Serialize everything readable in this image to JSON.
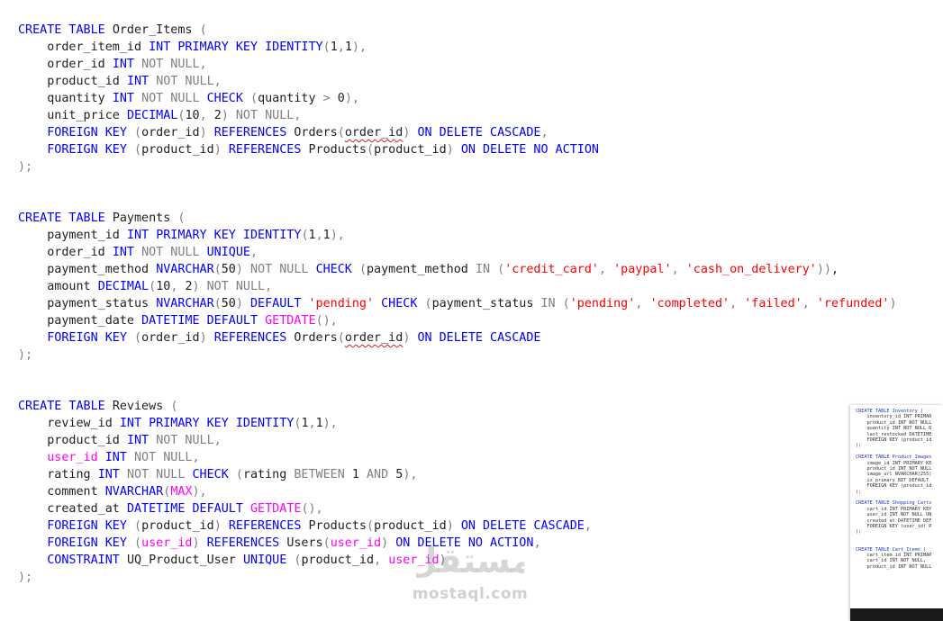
{
  "editor": {
    "lines": [
      [
        [
          "kw",
          "CREATE TABLE "
        ],
        [
          "pl",
          "Order_Items "
        ],
        [
          "gr",
          "("
        ]
      ],
      [
        [
          "pl",
          "    order_item_id "
        ],
        [
          "ty",
          "INT "
        ],
        [
          "kw",
          "PRIMARY KEY IDENTITY"
        ],
        [
          "gr",
          "("
        ],
        [
          "pl",
          "1"
        ],
        [
          "gr",
          ","
        ],
        [
          "pl",
          "1"
        ],
        [
          "gr",
          "),"
        ]
      ],
      [
        [
          "pl",
          "    order_id "
        ],
        [
          "ty",
          "INT "
        ],
        [
          "gr",
          "NOT NULL,"
        ]
      ],
      [
        [
          "pl",
          "    product_id "
        ],
        [
          "ty",
          "INT "
        ],
        [
          "gr",
          "NOT NULL,"
        ]
      ],
      [
        [
          "pl",
          "    quantity "
        ],
        [
          "ty",
          "INT "
        ],
        [
          "gr",
          "NOT NULL "
        ],
        [
          "kw",
          "CHECK "
        ],
        [
          "gr",
          "("
        ],
        [
          "pl",
          "quantity "
        ],
        [
          "gr",
          "> "
        ],
        [
          "pl",
          "0"
        ],
        [
          "gr",
          "),"
        ]
      ],
      [
        [
          "pl",
          "    unit_price "
        ],
        [
          "ty",
          "DECIMAL"
        ],
        [
          "gr",
          "("
        ],
        [
          "pl",
          "10"
        ],
        [
          "gr",
          ", "
        ],
        [
          "pl",
          "2"
        ],
        [
          "gr",
          ") NOT NULL,"
        ]
      ],
      [
        [
          "pl",
          "    "
        ],
        [
          "kw",
          "FOREIGN KEY "
        ],
        [
          "gr",
          "("
        ],
        [
          "pl",
          "order_id"
        ],
        [
          "gr",
          ") "
        ],
        [
          "kw",
          "REFERENCES "
        ],
        [
          "pl",
          "Orders"
        ],
        [
          "gr",
          "("
        ],
        [
          "sq",
          "order_id"
        ],
        [
          "gr",
          ") "
        ],
        [
          "kw",
          "ON DELETE CASCADE"
        ],
        [
          "gr",
          ","
        ]
      ],
      [
        [
          "pl",
          "    "
        ],
        [
          "kw",
          "FOREIGN KEY "
        ],
        [
          "gr",
          "("
        ],
        [
          "pl",
          "product_id"
        ],
        [
          "gr",
          ") "
        ],
        [
          "kw",
          "REFERENCES "
        ],
        [
          "pl",
          "Products"
        ],
        [
          "gr",
          "("
        ],
        [
          "pl",
          "product_id"
        ],
        [
          "gr",
          ") "
        ],
        [
          "kw",
          "ON DELETE NO ACTION"
        ]
      ],
      [
        [
          "gr",
          ");"
        ]
      ],
      [],
      [],
      [
        [
          "kw",
          "CREATE TABLE "
        ],
        [
          "pl",
          "Payments "
        ],
        [
          "gr",
          "("
        ]
      ],
      [
        [
          "pl",
          "    payment_id "
        ],
        [
          "ty",
          "INT "
        ],
        [
          "kw",
          "PRIMARY KEY IDENTITY"
        ],
        [
          "gr",
          "("
        ],
        [
          "pl",
          "1"
        ],
        [
          "gr",
          ","
        ],
        [
          "pl",
          "1"
        ],
        [
          "gr",
          "),"
        ]
      ],
      [
        [
          "pl",
          "    order_id "
        ],
        [
          "ty",
          "INT "
        ],
        [
          "gr",
          "NOT NULL "
        ],
        [
          "kw",
          "UNIQUE"
        ],
        [
          "gr",
          ","
        ]
      ],
      [
        [
          "pl",
          "    payment_method "
        ],
        [
          "ty",
          "NVARCHAR"
        ],
        [
          "gr",
          "("
        ],
        [
          "pl",
          "50"
        ],
        [
          "gr",
          ") NOT NULL "
        ],
        [
          "kw",
          "CHECK "
        ],
        [
          "gr",
          "("
        ],
        [
          "pl",
          "payment_method "
        ],
        [
          "gr",
          "IN ("
        ],
        [
          "st",
          "'credit_card'"
        ],
        [
          "gr",
          ", "
        ],
        [
          "st",
          "'paypal'"
        ],
        [
          "gr",
          ", "
        ],
        [
          "st",
          "'cash_on_delivery'"
        ],
        [
          "gr",
          "))"
        ],
        [
          "pl",
          ","
        ]
      ],
      [
        [
          "pl",
          "    amount "
        ],
        [
          "ty",
          "DECIMAL"
        ],
        [
          "gr",
          "("
        ],
        [
          "pl",
          "10"
        ],
        [
          "gr",
          ", "
        ],
        [
          "pl",
          "2"
        ],
        [
          "gr",
          ") NOT NULL,"
        ]
      ],
      [
        [
          "pl",
          "    payment_status "
        ],
        [
          "ty",
          "NVARCHAR"
        ],
        [
          "gr",
          "("
        ],
        [
          "pl",
          "50"
        ],
        [
          "gr",
          ") "
        ],
        [
          "kw",
          "DEFAULT "
        ],
        [
          "st",
          "'pending' "
        ],
        [
          "kw",
          "CHECK "
        ],
        [
          "gr",
          "("
        ],
        [
          "pl",
          "payment_status "
        ],
        [
          "gr",
          "IN ("
        ],
        [
          "st",
          "'pending'"
        ],
        [
          "gr",
          ", "
        ],
        [
          "st",
          "'completed'"
        ],
        [
          "gr",
          ", "
        ],
        [
          "st",
          "'failed'"
        ],
        [
          "gr",
          ", "
        ],
        [
          "st",
          "'refunded'"
        ],
        [
          "gr",
          ")"
        ]
      ],
      [
        [
          "pl",
          "    payment_date "
        ],
        [
          "ty",
          "DATETIME "
        ],
        [
          "kw",
          "DEFAULT "
        ],
        [
          "fn",
          "GETDATE"
        ],
        [
          "gr",
          "(),"
        ]
      ],
      [
        [
          "pl",
          "    "
        ],
        [
          "kw",
          "FOREIGN KEY "
        ],
        [
          "gr",
          "("
        ],
        [
          "pl",
          "order_id"
        ],
        [
          "gr",
          ") "
        ],
        [
          "kw",
          "REFERENCES "
        ],
        [
          "pl",
          "Orders"
        ],
        [
          "gr",
          "("
        ],
        [
          "sq",
          "order_id"
        ],
        [
          "gr",
          ") "
        ],
        [
          "kw",
          "ON DELETE CASCADE"
        ]
      ],
      [
        [
          "gr",
          ");"
        ]
      ],
      [],
      [],
      [
        [
          "kw",
          "CREATE TABLE "
        ],
        [
          "pl",
          "Reviews "
        ],
        [
          "gr",
          "("
        ]
      ],
      [
        [
          "pl",
          "    review_id "
        ],
        [
          "ty",
          "INT "
        ],
        [
          "kw",
          "PRIMARY KEY IDENTITY"
        ],
        [
          "gr",
          "("
        ],
        [
          "pl",
          "1"
        ],
        [
          "gr",
          ","
        ],
        [
          "pl",
          "1"
        ],
        [
          "gr",
          "),"
        ]
      ],
      [
        [
          "pl",
          "    product_id "
        ],
        [
          "ty",
          "INT "
        ],
        [
          "gr",
          "NOT NULL,"
        ]
      ],
      [
        [
          "fn",
          "    user_id "
        ],
        [
          "ty",
          "INT "
        ],
        [
          "gr",
          "NOT NULL,"
        ]
      ],
      [
        [
          "pl",
          "    rating "
        ],
        [
          "ty",
          "INT "
        ],
        [
          "gr",
          "NOT NULL "
        ],
        [
          "kw",
          "CHECK "
        ],
        [
          "gr",
          "("
        ],
        [
          "pl",
          "rating "
        ],
        [
          "gr",
          "BETWEEN "
        ],
        [
          "pl",
          "1 "
        ],
        [
          "gr",
          "AND "
        ],
        [
          "pl",
          "5"
        ],
        [
          "gr",
          "),"
        ]
      ],
      [
        [
          "pl",
          "    comment "
        ],
        [
          "ty",
          "NVARCHAR"
        ],
        [
          "gr",
          "("
        ],
        [
          "fn",
          "MAX"
        ],
        [
          "gr",
          "),"
        ]
      ],
      [
        [
          "pl",
          "    created_at "
        ],
        [
          "ty",
          "DATETIME "
        ],
        [
          "kw",
          "DEFAULT "
        ],
        [
          "fn",
          "GETDATE"
        ],
        [
          "gr",
          "(),"
        ]
      ],
      [
        [
          "pl",
          "    "
        ],
        [
          "kw",
          "FOREIGN KEY "
        ],
        [
          "gr",
          "("
        ],
        [
          "pl",
          "product_id"
        ],
        [
          "gr",
          ") "
        ],
        [
          "kw",
          "REFERENCES "
        ],
        [
          "pl",
          "Products"
        ],
        [
          "gr",
          "("
        ],
        [
          "pl",
          "product_id"
        ],
        [
          "gr",
          ") "
        ],
        [
          "kw",
          "ON DELETE CASCADE"
        ],
        [
          "gr",
          ","
        ]
      ],
      [
        [
          "pl",
          "    "
        ],
        [
          "kw",
          "FOREIGN KEY "
        ],
        [
          "gr",
          "("
        ],
        [
          "fn",
          "user_id"
        ],
        [
          "gr",
          ") "
        ],
        [
          "kw",
          "REFERENCES "
        ],
        [
          "pl",
          "Users"
        ],
        [
          "gr",
          "("
        ],
        [
          "fn",
          "user_id"
        ],
        [
          "gr",
          ") "
        ],
        [
          "kw",
          "ON DELETE NO ACTION"
        ],
        [
          "gr",
          ","
        ]
      ],
      [
        [
          "pl",
          "    "
        ],
        [
          "kw",
          "CONSTRAINT "
        ],
        [
          "pl",
          "UQ_Product_User "
        ],
        [
          "kw",
          "UNIQUE "
        ],
        [
          "gr",
          "("
        ],
        [
          "pl",
          "product_id"
        ],
        [
          "gr",
          ", "
        ],
        [
          "fn",
          "user_id"
        ],
        [
          "gr",
          ")"
        ]
      ],
      [
        [
          "gr",
          ");"
        ]
      ]
    ]
  },
  "minimap": {
    "lines": [
      "CREATE TABLE Inventory (",
      "    inventory_id INT PRIMAR",
      "    product_id INT NOT NULL",
      "    quantity INT NOT NULL D",
      "    last_restocked DATETIME",
      "    FOREIGN KEY (product_id",
      ");",
      "",
      "CREATE TABLE Product_Images",
      "    image_id INT PRIMARY KE",
      "    product_id INT NOT NULL",
      "    image_url NVARCHAR(255)",
      "    is_primary BIT DEFAULT",
      "    FOREIGN KEY (product_id",
      ");",
      "",
      "CREATE TABLE Shopping_Carts",
      "    cart_id INT PRIMARY KEY",
      "    user_id INT NOT NULL UN",
      "    created_at DATETIME DEF",
      "    FOREIGN KEY (user_id) R",
      ");",
      "",
      "",
      "CREATE TABLE Cart_Items (",
      "    cart_item_id INT PRIMAR",
      "    cart_id INT NOT NULL,",
      "    product_id INT NOT NULL"
    ]
  },
  "watermark": {
    "arabic": "مستقل",
    "text": "mostaql.com"
  }
}
